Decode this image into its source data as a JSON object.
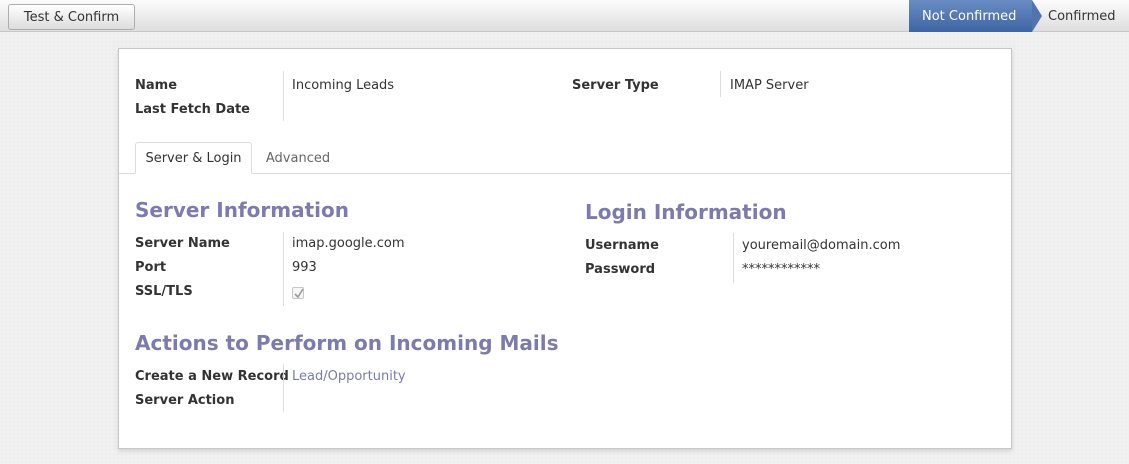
{
  "statusbar": {
    "test_button": "Test & Confirm",
    "stages": [
      "Not Confirmed",
      "Confirmed"
    ],
    "active_stage": "Not Confirmed",
    "active_color": "#4a6fae"
  },
  "header": {
    "name_label": "Name",
    "name_value": "Incoming Leads",
    "last_fetch_label": "Last Fetch Date",
    "last_fetch_value": "",
    "server_type_label": "Server Type",
    "server_type_value": "IMAP Server"
  },
  "tabs": [
    "Server & Login",
    "Advanced"
  ],
  "server_info": {
    "title": "Server Information",
    "server_name_label": "Server Name",
    "server_name_value": "imap.google.com",
    "port_label": "Port",
    "port_value": "993",
    "ssl_label": "SSL/TLS",
    "ssl_checked": true
  },
  "login_info": {
    "title": "Login Information",
    "username_label": "Username",
    "username_value": "youremail@domain.com",
    "password_label": "Password",
    "password_value": "************"
  },
  "actions": {
    "title": "Actions to Perform on Incoming Mails",
    "create_record_label": "Create a New Record",
    "create_record_value": "Lead/Opportunity",
    "server_action_label": "Server Action",
    "server_action_value": ""
  },
  "colors": {
    "section_title": "#7c7bad",
    "link": "#7c7bad"
  }
}
